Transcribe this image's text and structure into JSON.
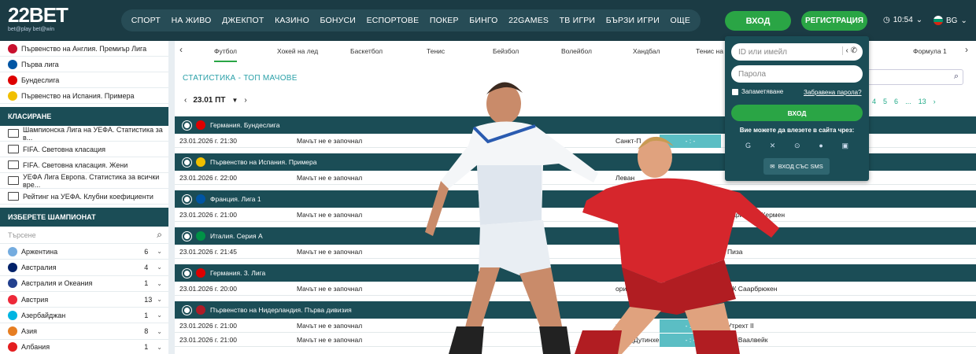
{
  "header": {
    "logo_text": "22BET",
    "logo_tagline": "bet@play  bet@win",
    "nav": [
      "СПОРТ",
      "НА ЖИВО",
      "ДЖЕКПОТ",
      "КАЗИНО",
      "БОНУСИ",
      "ЕСПОРТОВЕ",
      "ПОКЕР",
      "БИНГО",
      "22GAMES",
      "ТВ ИГРИ",
      "БЪРЗИ ИГРИ",
      "ОЩЕ"
    ],
    "login_label": "ВХОД",
    "register_label": "РЕГИСТРАЦИЯ",
    "time": "10:54",
    "lang": "BG"
  },
  "sidebar": {
    "top_items": [
      {
        "label": "Първенство на Англия. Премиър Лига",
        "flag": "#c8102e"
      },
      {
        "label": "Първа лига",
        "flag": "#0055a4"
      },
      {
        "label": "Бундеслига",
        "flag": "#dd0000"
      },
      {
        "label": "Първенство на Испания. Примера",
        "flag": "#f1bf00"
      }
    ],
    "ranking_heading": "КЛАСИРАНЕ",
    "ranking_items": [
      "Шампионска Лига на УЕФА. Статистика за в...",
      "FIFA. Световна класация",
      "FIFA. Световна класация. Жени",
      "УЕФА Лига Европа. Статистика за всички вре...",
      "Рейтинг на УЕФА. Клубни коефициенти"
    ],
    "champ_heading": "ИЗБЕРЕТЕ ШАМПИОНАТ",
    "search_placeholder": "Търсене",
    "championships": [
      {
        "name": "Аржентина",
        "count": "6",
        "flag": "#74acdf"
      },
      {
        "name": "Австралия",
        "count": "4",
        "flag": "#012169"
      },
      {
        "name": "Австралия и Океания",
        "count": "1",
        "flag": "#23408e"
      },
      {
        "name": "Австрия",
        "count": "13",
        "flag": "#ed2939"
      },
      {
        "name": "Азербайджан",
        "count": "1",
        "flag": "#00b5e2"
      },
      {
        "name": "Азия",
        "count": "8",
        "flag": "#e67e22"
      },
      {
        "name": "Албания",
        "count": "1",
        "flag": "#e41e20"
      }
    ]
  },
  "main": {
    "tabs": [
      "Футбол",
      "Хокей на лед",
      "Баскетбол",
      "Тенис",
      "Бейзбол",
      "Волейбол",
      "Хандбал",
      "Тенис на м",
      "",
      "Формула 1"
    ],
    "stats_title": "СТАТИСТИКА - ТОП МАЧОВЕ",
    "date": "23.01 ПТ",
    "pager": [
      "3",
      "4",
      "5",
      "6",
      "...",
      "13"
    ],
    "leagues": [
      {
        "name": "Германия. Бундеслига",
        "flag": "#dd0000",
        "matches": [
          {
            "dt": "23.01.2026 г. 21:30",
            "status": "Мачът не е започнал",
            "home": "Санкт-П",
            "score": "- : -",
            "away": ""
          }
        ]
      },
      {
        "name": "Първенство на Испания. Примера",
        "flag": "#f1bf00",
        "matches": [
          {
            "dt": "23.01.2026 г. 22:00",
            "status": "Мачът не е започнал",
            "home": "Леван",
            "score": "",
            "away": ""
          }
        ]
      },
      {
        "name": "Франция. Лига 1",
        "flag": "#0055a4",
        "matches": [
          {
            "dt": "23.01.2026 г. 21:00",
            "status": "Мачът не е започнал",
            "home": "",
            "score": "- : -",
            "away": "Пари Сен Жермен"
          }
        ]
      },
      {
        "name": "Италия. Серия А",
        "flag": "#009246",
        "matches": [
          {
            "dt": "23.01.2026 г. 21:45",
            "status": "Мачът не е започнал",
            "home": "",
            "score": "- : -",
            "away": "Пиза"
          }
        ]
      },
      {
        "name": "Германия. 3. Лига",
        "flag": "#dd0000",
        "matches": [
          {
            "dt": "23.01.2026 г. 20:00",
            "status": "Мачът не е започнал",
            "home": "орим",
            "score": "- : -",
            "away": "ФК Саарбрюкен"
          }
        ]
      },
      {
        "name": "Първенство на Нидерландия. Първа дивизия",
        "flag": "#ae1c28",
        "matches": [
          {
            "dt": "23.01.2026 г. 21:00",
            "status": "Мачът не е започнал",
            "home": "ихт",
            "score": "- : -",
            "away": "Утрехт II"
          },
          {
            "dt": "23.01.2026 г. 21:00",
            "status": "Мачът не е започнал",
            "home": "схап (Дутинхем)",
            "score": "- : -",
            "away": "ФК Ваалвейк"
          }
        ]
      }
    ]
  },
  "login_popup": {
    "id_placeholder": "ID или имейл",
    "password_placeholder": "Парола",
    "remember_label": "Запаметяване",
    "forgot_label": "Забравена парола?",
    "submit_label": "ВХОД",
    "via_label": "Вие можете да влезете в сайта чрез:",
    "socials": [
      "google-icon",
      "x-icon",
      "telegram-icon",
      "apple-icon",
      "steam-icon"
    ],
    "sms_label": "ВХОД СЪС SMS"
  }
}
